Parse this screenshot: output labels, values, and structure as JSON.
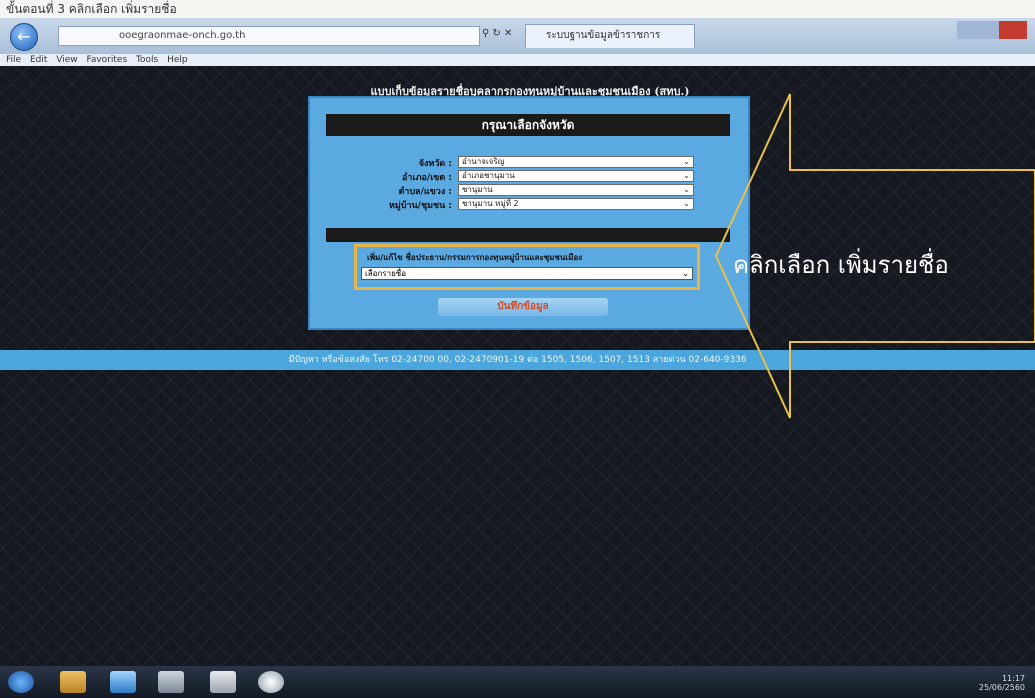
{
  "caption": "ขั้นตอนที่ 3 คลิกเลือก เพิ่มรายชื่อ",
  "browser": {
    "address": "ooegraonmae-onch.go.th",
    "tab_title": "ระบบฐานข้อมูลข้าราชการ",
    "menu": [
      "File",
      "Edit",
      "View",
      "Favorites",
      "Tools",
      "Help"
    ]
  },
  "form": {
    "title": "แบบเก็บข้อมูลรายชื่อบุคลากรกองทุนหมู่บ้านและชุมชนเมือง (สทบ.)",
    "header": "กรุณาเลือกจังหวัด",
    "fields": [
      {
        "label": "จังหวัด :",
        "value": "อำนาจเจริญ"
      },
      {
        "label": "อำเภอ/เขต :",
        "value": "อำเภอชานุมาน"
      },
      {
        "label": "ตำบล/แขวง :",
        "value": "ชานุมาน"
      },
      {
        "label": "หมู่บ้าน/ชุมชน :",
        "value": "ชานุมาน หมู่ที่ 2"
      }
    ],
    "add_label": "เพิ่ม/แก้ไข ชื่อประธาน/กรรมการกองทุนหมู่บ้านและชุมชนเมือง",
    "add_select": "เลือกรายชื่อ",
    "confirm_button": "บันทึกข้อมูล"
  },
  "contact": "มีปัญหา หรือข้อสงสัย โทร 02-24700 00, 02-2470901-19 ต่อ 1505, 1506, 1507, 1513 สายด่วน 02-640-9336",
  "annotation": "คลิกเลือก เพิ่มรายชื่อ",
  "taskbar": {
    "clock_time": "11:17",
    "clock_date": "25/06/2560"
  }
}
